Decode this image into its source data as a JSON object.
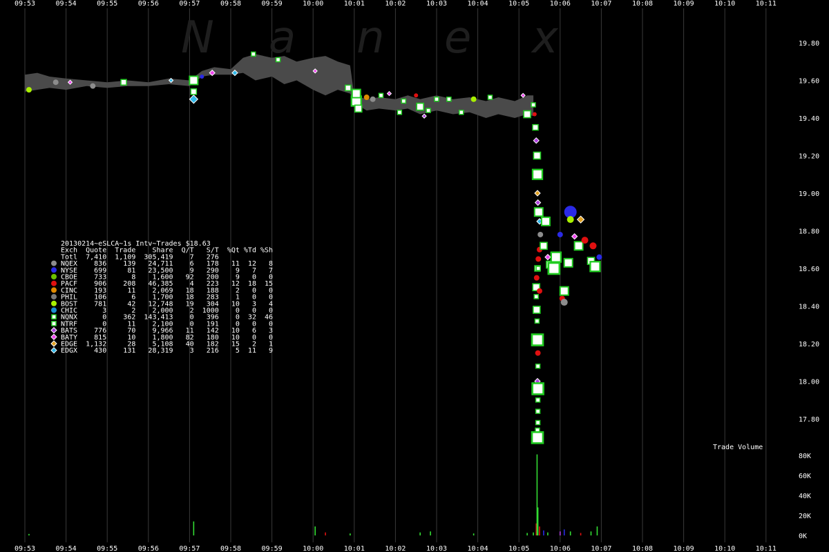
{
  "chart_data": {
    "type": "scatter",
    "watermark": [
      "N",
      "a",
      "n",
      "e",
      "x"
    ],
    "x_ticks": [
      "09:53",
      "09:54",
      "09:55",
      "09:56",
      "09:57",
      "09:58",
      "09:59",
      "10:00",
      "10:01",
      "10:02",
      "10:03",
      "10:04",
      "10:05",
      "10:06",
      "10:07",
      "10:08",
      "10:09",
      "10:10",
      "10:11"
    ],
    "y_ticks": [
      "19.80",
      "19.60",
      "19.40",
      "19.20",
      "19.00",
      "18.80",
      "18.60",
      "18.40",
      "18.20",
      "18.00",
      "17.80"
    ],
    "ylim": [
      17.6,
      19.9
    ],
    "volume_label": "Trade Volume",
    "volume_ticks": [
      "80K",
      "60K",
      "40K",
      "20K",
      "0K"
    ],
    "volume_lim": [
      0,
      80000
    ],
    "legend": {
      "title": "20130214~eSLCA~1s Intv~Trades $18.63",
      "header": "Exch  Quote  Trade    Share  Q/T   S/T  %Qt %Td %Sh",
      "total": "Totl  7,410  1,109  305,419    7   276",
      "rows": [
        {
          "exch": "NQEX",
          "color": "#8c8c8c",
          "shape": "circle",
          "text": "NQEX    836    139   24,711    6   178   11  12   8"
        },
        {
          "exch": "NYSE",
          "color": "#2a2ae6",
          "shape": "circle",
          "text": "NYSE    699     81   23,500    9   290    9   7   7"
        },
        {
          "exch": "CBOE",
          "color": "#6cc000",
          "shape": "circle",
          "text": "CBOE    733      8    1,600   92   200    9   0   0"
        },
        {
          "exch": "PACF",
          "color": "#e01010",
          "shape": "circle",
          "text": "PACF    906    208   46,385    4   223   12  18  15"
        },
        {
          "exch": "CINC",
          "color": "#e08a00",
          "shape": "circle",
          "text": "CINC    193     11    2,069   18   188    2   0   0"
        },
        {
          "exch": "PHIL",
          "color": "#7a7a7a",
          "shape": "circle",
          "text": "PHIL    106      6    1,700   18   283    1   0   0"
        },
        {
          "exch": "BOST",
          "color": "#a8f000",
          "shape": "circle",
          "text": "BOST    781     42   12,748   19   304   10   3   4"
        },
        {
          "exch": "CHIC",
          "color": "#1a8fd0",
          "shape": "circle",
          "text": "CHIC      3      2    2,000    2  1000    0   0   0"
        },
        {
          "exch": "NQNX",
          "color": "#22cc22",
          "shape": "square",
          "text": "NQNX      0    362  143,413    0   396    0  32  46"
        },
        {
          "exch": "NTRF",
          "color": "#33dd33",
          "shape": "square",
          "text": "NTRF      0     11    2,100    0   191    0   0   0"
        },
        {
          "exch": "BATS",
          "color": "#b040e0",
          "shape": "diamond",
          "text": "BATS    776     70    9,966   11   142   10   6   3"
        },
        {
          "exch": "BATY",
          "color": "#ee44ee",
          "shape": "diamond",
          "text": "BATY    815     10    1,800   82   180   10   0   0"
        },
        {
          "exch": "EDGE",
          "color": "#e0a020",
          "shape": "diamond",
          "text": "EDGE  1,132     28    5,108   40   182   15   2   1"
        },
        {
          "exch": "EDGX",
          "color": "#30b8e8",
          "shape": "diamond",
          "text": "EDGX    430    131   28,319    3   216    5  11   9"
        }
      ]
    },
    "quote_band": {
      "color": "#4a4a4a",
      "points": [
        {
          "t": 0.0,
          "lo": 19.54,
          "hi": 19.63
        },
        {
          "t": 0.3,
          "lo": 19.55,
          "hi": 19.64
        },
        {
          "t": 0.6,
          "lo": 19.56,
          "hi": 19.62
        },
        {
          "t": 1.0,
          "lo": 19.55,
          "hi": 19.61
        },
        {
          "t": 1.5,
          "lo": 19.57,
          "hi": 19.6
        },
        {
          "t": 2.0,
          "lo": 19.56,
          "hi": 19.59
        },
        {
          "t": 2.5,
          "lo": 19.57,
          "hi": 19.6
        },
        {
          "t": 3.0,
          "lo": 19.57,
          "hi": 19.59
        },
        {
          "t": 3.5,
          "lo": 19.58,
          "hi": 19.61
        },
        {
          "t": 4.0,
          "lo": 19.57,
          "hi": 19.6
        },
        {
          "t": 4.3,
          "lo": 19.62,
          "hi": 19.65
        },
        {
          "t": 4.6,
          "lo": 19.63,
          "hi": 19.67
        },
        {
          "t": 5.0,
          "lo": 19.63,
          "hi": 19.66
        },
        {
          "t": 5.3,
          "lo": 19.64,
          "hi": 19.72
        },
        {
          "t": 5.6,
          "lo": 19.6,
          "hi": 19.74
        },
        {
          "t": 6.0,
          "lo": 19.62,
          "hi": 19.72
        },
        {
          "t": 6.3,
          "lo": 19.58,
          "hi": 19.73
        },
        {
          "t": 6.6,
          "lo": 19.6,
          "hi": 19.7
        },
        {
          "t": 7.0,
          "lo": 19.55,
          "hi": 19.72
        },
        {
          "t": 7.3,
          "lo": 19.52,
          "hi": 19.73
        },
        {
          "t": 7.6,
          "lo": 19.55,
          "hi": 19.7
        },
        {
          "t": 7.9,
          "lo": 19.53,
          "hi": 19.68
        },
        {
          "t": 8.0,
          "lo": 19.48,
          "hi": 19.52
        },
        {
          "t": 8.3,
          "lo": 19.44,
          "hi": 19.5
        },
        {
          "t": 8.6,
          "lo": 19.45,
          "hi": 19.51
        },
        {
          "t": 9.0,
          "lo": 19.44,
          "hi": 19.5
        },
        {
          "t": 9.3,
          "lo": 19.45,
          "hi": 19.52
        },
        {
          "t": 9.6,
          "lo": 19.42,
          "hi": 19.5
        },
        {
          "t": 10.0,
          "lo": 19.44,
          "hi": 19.52
        },
        {
          "t": 10.4,
          "lo": 19.42,
          "hi": 19.5
        },
        {
          "t": 10.8,
          "lo": 19.43,
          "hi": 19.51
        },
        {
          "t": 11.2,
          "lo": 19.4,
          "hi": 19.49
        },
        {
          "t": 11.5,
          "lo": 19.42,
          "hi": 19.51
        },
        {
          "t": 11.9,
          "lo": 19.4,
          "hi": 19.49
        },
        {
          "t": 12.2,
          "lo": 19.42,
          "hi": 19.52
        },
        {
          "t": 12.35,
          "lo": 19.41,
          "hi": 19.52
        }
      ]
    },
    "trades": [
      {
        "t": 0.1,
        "p": 19.55,
        "e": "BOST",
        "s": 4
      },
      {
        "t": 0.75,
        "p": 19.59,
        "e": "NQEX",
        "s": 4
      },
      {
        "t": 1.1,
        "p": 19.59,
        "e": "BATY",
        "s": 3
      },
      {
        "t": 1.65,
        "p": 19.57,
        "e": "NQEX",
        "s": 4
      },
      {
        "t": 2.4,
        "p": 19.59,
        "e": "NQNX",
        "s": 4
      },
      {
        "t": 3.55,
        "p": 19.6,
        "e": "EDGX",
        "s": 3
      },
      {
        "t": 4.1,
        "p": 19.6,
        "e": "NQNX",
        "s": 6
      },
      {
        "t": 4.1,
        "p": 19.5,
        "e": "EDGX",
        "s": 6
      },
      {
        "t": 4.1,
        "p": 19.54,
        "e": "NTRF",
        "s": 4
      },
      {
        "t": 4.3,
        "p": 19.62,
        "e": "NYSE",
        "s": 3
      },
      {
        "t": 4.55,
        "p": 19.64,
        "e": "BATY",
        "s": 4
      },
      {
        "t": 5.1,
        "p": 19.64,
        "e": "EDGX",
        "s": 4
      },
      {
        "t": 5.55,
        "p": 19.74,
        "e": "NQNX",
        "s": 3
      },
      {
        "t": 6.15,
        "p": 19.71,
        "e": "NQNX",
        "s": 3
      },
      {
        "t": 7.05,
        "p": 19.65,
        "e": "BATY",
        "s": 3
      },
      {
        "t": 7.85,
        "p": 19.56,
        "e": "NQNX",
        "s": 4
      },
      {
        "t": 8.05,
        "p": 19.49,
        "e": "NQNX",
        "s": 7
      },
      {
        "t": 8.05,
        "p": 19.53,
        "e": "NQNX",
        "s": 6
      },
      {
        "t": 8.1,
        "p": 19.45,
        "e": "NQNX",
        "s": 5
      },
      {
        "t": 8.3,
        "p": 19.51,
        "e": "CINC",
        "s": 4
      },
      {
        "t": 8.45,
        "p": 19.5,
        "e": "NQEX",
        "s": 4
      },
      {
        "t": 8.65,
        "p": 19.52,
        "e": "NQNX",
        "s": 3
      },
      {
        "t": 8.85,
        "p": 19.53,
        "e": "BATY",
        "s": 3
      },
      {
        "t": 9.1,
        "p": 19.43,
        "e": "NQNX",
        "s": 3
      },
      {
        "t": 9.2,
        "p": 19.49,
        "e": "NQNX",
        "s": 3
      },
      {
        "t": 9.5,
        "p": 19.52,
        "e": "PACF",
        "s": 3
      },
      {
        "t": 9.6,
        "p": 19.46,
        "e": "NQNX",
        "s": 5
      },
      {
        "t": 9.7,
        "p": 19.41,
        "e": "BATS",
        "s": 3
      },
      {
        "t": 9.8,
        "p": 19.44,
        "e": "NQNX",
        "s": 3
      },
      {
        "t": 10.0,
        "p": 19.5,
        "e": "NQNX",
        "s": 3
      },
      {
        "t": 10.3,
        "p": 19.5,
        "e": "NQNX",
        "s": 3
      },
      {
        "t": 10.6,
        "p": 19.43,
        "e": "NQNX",
        "s": 3
      },
      {
        "t": 10.9,
        "p": 19.5,
        "e": "BOST",
        "s": 4
      },
      {
        "t": 11.3,
        "p": 19.51,
        "e": "NQNX",
        "s": 3
      },
      {
        "t": 12.1,
        "p": 19.52,
        "e": "BATY",
        "s": 3
      },
      {
        "t": 12.2,
        "p": 19.42,
        "e": "NQNX",
        "s": 5
      },
      {
        "t": 12.35,
        "p": 19.47,
        "e": "NQNX",
        "s": 3
      },
      {
        "t": 12.38,
        "p": 19.42,
        "e": "PACF",
        "s": 3
      },
      {
        "t": 12.4,
        "p": 19.35,
        "e": "NQNX",
        "s": 4
      },
      {
        "t": 12.42,
        "p": 19.28,
        "e": "BATS",
        "s": 4
      },
      {
        "t": 12.44,
        "p": 19.2,
        "e": "NQNX",
        "s": 5
      },
      {
        "t": 12.45,
        "p": 19.1,
        "e": "NQNX",
        "s": 7
      },
      {
        "t": 12.45,
        "p": 19.0,
        "e": "EDGE",
        "s": 4
      },
      {
        "t": 12.46,
        "p": 18.95,
        "e": "BATS",
        "s": 4
      },
      {
        "t": 12.48,
        "p": 18.9,
        "e": "NQNX",
        "s": 6
      },
      {
        "t": 12.5,
        "p": 18.85,
        "e": "EDGX",
        "s": 4
      },
      {
        "t": 12.52,
        "p": 18.78,
        "e": "NQEX",
        "s": 4
      },
      {
        "t": 12.5,
        "p": 18.7,
        "e": "PACF",
        "s": 4
      },
      {
        "t": 12.47,
        "p": 18.65,
        "e": "PACF",
        "s": 4
      },
      {
        "t": 12.45,
        "p": 18.6,
        "e": "NQNX",
        "s": 4
      },
      {
        "t": 12.43,
        "p": 18.55,
        "e": "PACF",
        "s": 4
      },
      {
        "t": 12.42,
        "p": 18.5,
        "e": "NQNX",
        "s": 5
      },
      {
        "t": 12.42,
        "p": 18.45,
        "e": "NQNX",
        "s": 3
      },
      {
        "t": 12.43,
        "p": 18.38,
        "e": "NQNX",
        "s": 5
      },
      {
        "t": 12.44,
        "p": 18.32,
        "e": "NQNX",
        "s": 3
      },
      {
        "t": 12.45,
        "p": 18.22,
        "e": "NQNX",
        "s": 8
      },
      {
        "t": 12.46,
        "p": 18.15,
        "e": "PACF",
        "s": 4
      },
      {
        "t": 12.46,
        "p": 18.08,
        "e": "NQNX",
        "s": 3
      },
      {
        "t": 12.45,
        "p": 18.0,
        "e": "BATS",
        "s": 4
      },
      {
        "t": 12.46,
        "p": 17.96,
        "e": "NQNX",
        "s": 8
      },
      {
        "t": 12.46,
        "p": 17.9,
        "e": "NQNX",
        "s": 3
      },
      {
        "t": 12.46,
        "p": 17.84,
        "e": "NQNX",
        "s": 3
      },
      {
        "t": 12.46,
        "p": 17.78,
        "e": "NQNX",
        "s": 3
      },
      {
        "t": 12.45,
        "p": 17.74,
        "e": "NQNX",
        "s": 3
      },
      {
        "t": 12.45,
        "p": 17.7,
        "e": "NQNX",
        "s": 8
      },
      {
        "t": 12.47,
        "p": 18.6,
        "e": "NQNX",
        "s": 3
      },
      {
        "t": 12.5,
        "p": 18.48,
        "e": "PACF",
        "s": 4
      },
      {
        "t": 12.6,
        "p": 18.72,
        "e": "NQNX",
        "s": 5
      },
      {
        "t": 12.65,
        "p": 18.85,
        "e": "NQNX",
        "s": 6
      },
      {
        "t": 12.7,
        "p": 18.66,
        "e": "BATY",
        "s": 4
      },
      {
        "t": 12.75,
        "p": 18.62,
        "e": "NQNX",
        "s": 5
      },
      {
        "t": 12.85,
        "p": 18.6,
        "e": "NQNX",
        "s": 8
      },
      {
        "t": 12.9,
        "p": 18.66,
        "e": "NQNX",
        "s": 7
      },
      {
        "t": 13.0,
        "p": 18.78,
        "e": "NYSE",
        "s": 4
      },
      {
        "t": 13.05,
        "p": 18.44,
        "e": "PACF",
        "s": 4
      },
      {
        "t": 13.1,
        "p": 18.48,
        "e": "NQNX",
        "s": 6
      },
      {
        "t": 13.1,
        "p": 18.42,
        "e": "NQEX",
        "s": 5
      },
      {
        "t": 13.2,
        "p": 18.63,
        "e": "NQNX",
        "s": 6
      },
      {
        "t": 13.25,
        "p": 18.9,
        "e": "NYSE",
        "s": 9
      },
      {
        "t": 13.25,
        "p": 18.86,
        "e": "BOST",
        "s": 5
      },
      {
        "t": 13.35,
        "p": 18.77,
        "e": "BATY",
        "s": 4
      },
      {
        "t": 13.45,
        "p": 18.72,
        "e": "NQNX",
        "s": 6
      },
      {
        "t": 13.5,
        "p": 18.86,
        "e": "EDGE",
        "s": 5
      },
      {
        "t": 13.6,
        "p": 18.75,
        "e": "PACF",
        "s": 5
      },
      {
        "t": 13.75,
        "p": 18.64,
        "e": "NQNX",
        "s": 5
      },
      {
        "t": 13.8,
        "p": 18.72,
        "e": "PACF",
        "s": 5
      },
      {
        "t": 13.85,
        "p": 18.61,
        "e": "NQNX",
        "s": 7
      },
      {
        "t": 13.95,
        "p": 18.66,
        "e": "NYSE",
        "s": 4
      }
    ],
    "volume": [
      {
        "t": 0.1,
        "v": 1500,
        "c": "#33dd33"
      },
      {
        "t": 4.1,
        "v": 14000,
        "c": "#33dd33"
      },
      {
        "t": 7.05,
        "v": 9000,
        "c": "#33dd33"
      },
      {
        "t": 7.3,
        "v": 3000,
        "c": "#e01010"
      },
      {
        "t": 7.9,
        "v": 2000,
        "c": "#33dd33"
      },
      {
        "t": 9.6,
        "v": 3000,
        "c": "#33dd33"
      },
      {
        "t": 9.85,
        "v": 4000,
        "c": "#33dd33"
      },
      {
        "t": 10.9,
        "v": 2000,
        "c": "#33dd33"
      },
      {
        "t": 12.2,
        "v": 2500,
        "c": "#33dd33"
      },
      {
        "t": 12.35,
        "v": 3000,
        "c": "#33dd33"
      },
      {
        "t": 12.42,
        "v": 12000,
        "c": "#e01010"
      },
      {
        "t": 12.44,
        "v": 81000,
        "c": "#33dd33"
      },
      {
        "t": 12.46,
        "v": 28000,
        "c": "#33dd33"
      },
      {
        "t": 12.5,
        "v": 9000,
        "c": "#e01010"
      },
      {
        "t": 12.6,
        "v": 5000,
        "c": "#2a2ae6"
      },
      {
        "t": 12.7,
        "v": 3000,
        "c": "#33dd33"
      },
      {
        "t": 13.0,
        "v": 4000,
        "c": "#b040e0"
      },
      {
        "t": 13.1,
        "v": 6000,
        "c": "#2a2ae6"
      },
      {
        "t": 13.25,
        "v": 4000,
        "c": "#33dd33"
      },
      {
        "t": 13.5,
        "v": 2500,
        "c": "#e01010"
      },
      {
        "t": 13.75,
        "v": 4000,
        "c": "#33dd33"
      },
      {
        "t": 13.9,
        "v": 9000,
        "c": "#33dd33"
      }
    ]
  }
}
